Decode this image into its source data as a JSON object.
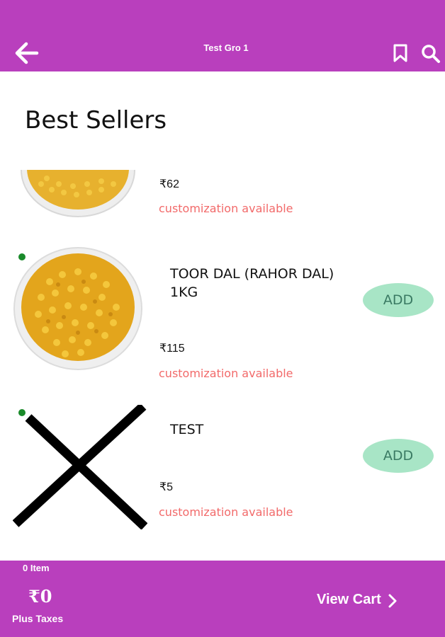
{
  "header": {
    "title": "Test Gro 1",
    "bg_color": "#b93fbd"
  },
  "section": {
    "heading": "Best Sellers"
  },
  "items": [
    {
      "price": "₹62",
      "customization": "customization available"
    },
    {
      "name": "TOOR DAL (RAHOR DAL) 1KG",
      "price": "₹115",
      "customization": "customization available",
      "add_label": "ADD",
      "veg_indicator_color": "#1a8a2a"
    },
    {
      "name": "TEST",
      "price": "₹5",
      "customization": "customization available",
      "add_label": "ADD",
      "veg_indicator_color": "#1a8a2a"
    }
  ],
  "cart": {
    "item_count": "0 Item",
    "total": "₹0",
    "taxes_note": "Plus Taxes",
    "view_cart_label": "View Cart"
  }
}
